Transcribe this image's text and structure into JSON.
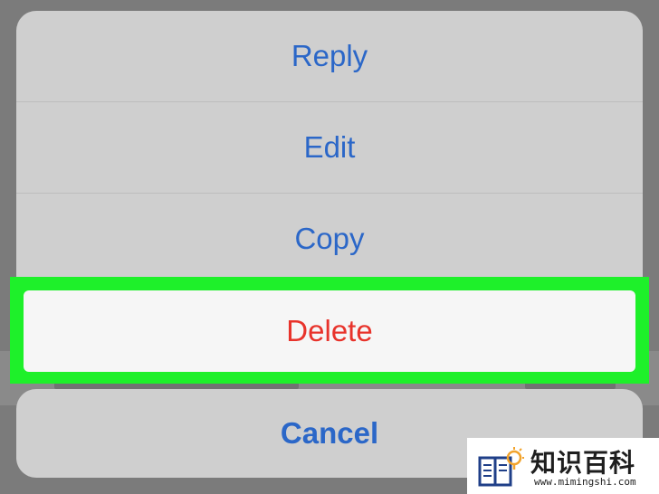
{
  "action_sheet": {
    "actions": [
      {
        "label": "Reply"
      },
      {
        "label": "Edit"
      },
      {
        "label": "Copy"
      }
    ],
    "destructive_action": {
      "label": "Delete"
    },
    "cancel": {
      "label": "Cancel"
    }
  },
  "watermark": {
    "title": "知识百科",
    "url": "www.mimingshi.com",
    "icon": "book-lightbulb-icon"
  },
  "colors": {
    "action_text": "#2b67c8",
    "destructive_text": "#e8332b",
    "highlight": "#1ef02a",
    "sheet_background": "#cfcfcf",
    "dim_overlay": "#7b7b7b"
  }
}
